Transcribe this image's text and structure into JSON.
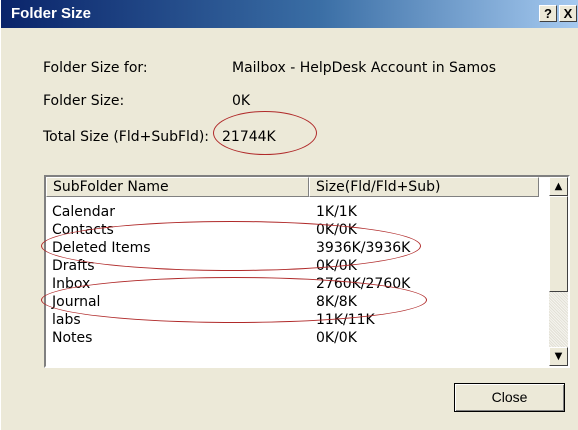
{
  "window": {
    "title": "Folder Size",
    "help_label": "?",
    "close_label": "X"
  },
  "info": {
    "folder_size_for_label": "Folder Size for:",
    "folder_size_for_value": "Mailbox - HelpDesk Account in Samos",
    "folder_size_label": "Folder Size:",
    "folder_size_value": "0K",
    "total_size_label": "Total Size (Fld+SubFld):",
    "total_size_value": "21744K"
  },
  "table": {
    "columns": [
      "SubFolder Name",
      "Size(Fld/Fld+Sub)"
    ],
    "rows": [
      {
        "name": "Calendar",
        "size": "1K/1K"
      },
      {
        "name": "Contacts",
        "size": "0K/0K"
      },
      {
        "name": "Deleted Items",
        "size": "3936K/3936K"
      },
      {
        "name": "Drafts",
        "size": "0K/0K"
      },
      {
        "name": "Inbox",
        "size": "2760K/2760K"
      },
      {
        "name": "Journal",
        "size": "8K/8K"
      },
      {
        "name": "labs",
        "size": "11K/11K"
      },
      {
        "name": "Notes",
        "size": "0K/0K"
      }
    ]
  },
  "scrollbar": {
    "up_arrow": "▲",
    "down_arrow": "▼"
  },
  "buttons": {
    "close_label": "Close"
  },
  "colors": {
    "annotation": "#b02a2a",
    "titlebar": "#0a246a",
    "dialog_bg": "#ece9d8"
  }
}
